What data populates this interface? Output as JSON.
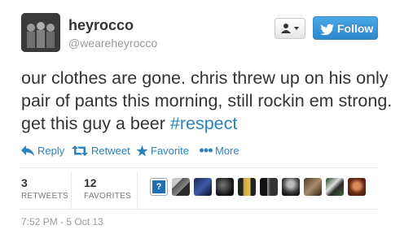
{
  "user": {
    "display_name": "heyrocco",
    "handle": "@weareheyrocco"
  },
  "buttons": {
    "follow_label": "Follow"
  },
  "tweet": {
    "text": "our clothes are gone. chris threw up on his only pair of pants this morning, still rockin em strong. get this guy a beer ",
    "hashtag": "#respect",
    "timestamp": "7:52 PM - 5 Oct 13"
  },
  "actions": {
    "reply": "Reply",
    "retweet": "Retweet",
    "favorite": "Favorite",
    "more": "More"
  },
  "stats": {
    "retweets_count": "3",
    "retweets_label": "RETWEETS",
    "favorites_count": "12",
    "favorites_label": "FAVORITES"
  },
  "favoriters": {
    "placeholder_glyph": "?"
  },
  "colors": {
    "link": "#2a83ba",
    "follow_bg": "#2e88cc"
  }
}
